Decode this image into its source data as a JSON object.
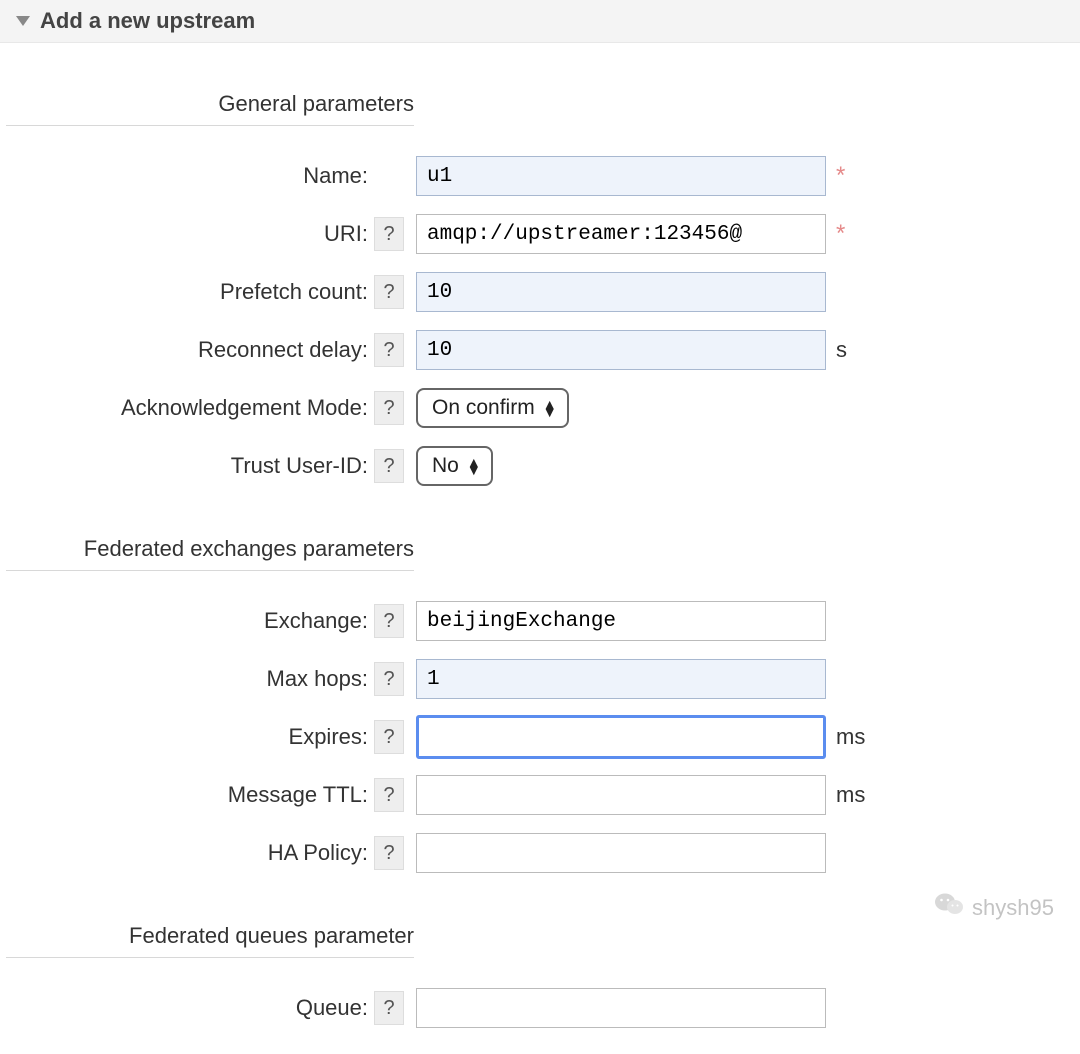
{
  "header": {
    "title": "Add a new upstream"
  },
  "groups": {
    "general": {
      "heading": "General parameters"
    },
    "fed_ex": {
      "heading": "Federated exchanges parameters"
    },
    "fed_q": {
      "heading": "Federated queues parameter"
    }
  },
  "fields": {
    "name": {
      "label": "Name:",
      "value": "u1",
      "required": true,
      "help": false
    },
    "uri": {
      "label": "URI:",
      "value": "amqp://upstreamer:123456@",
      "required": true,
      "help": true
    },
    "prefetch": {
      "label": "Prefetch count:",
      "value": "10",
      "help": true
    },
    "reconnect": {
      "label": "Reconnect delay:",
      "value": "10",
      "suffix": "s",
      "help": true
    },
    "ack_mode": {
      "label": "Acknowledgement Mode:",
      "value": "On confirm",
      "help": true,
      "type": "select"
    },
    "trust_uid": {
      "label": "Trust User-ID:",
      "value": "No",
      "help": true,
      "type": "select"
    },
    "exchange": {
      "label": "Exchange:",
      "value": "beijingExchange",
      "help": true
    },
    "max_hops": {
      "label": "Max hops:",
      "value": "1",
      "help": true
    },
    "expires": {
      "label": "Expires:",
      "value": "",
      "suffix": "ms",
      "help": true,
      "focused": true
    },
    "msg_ttl": {
      "label": "Message TTL:",
      "value": "",
      "suffix": "ms",
      "help": true
    },
    "ha_policy": {
      "label": "HA Policy:",
      "value": "",
      "help": true
    },
    "queue": {
      "label": "Queue:",
      "value": "",
      "help": true
    }
  },
  "help_label": "?",
  "required_mark": "*",
  "watermark": {
    "text": "shysh95"
  }
}
